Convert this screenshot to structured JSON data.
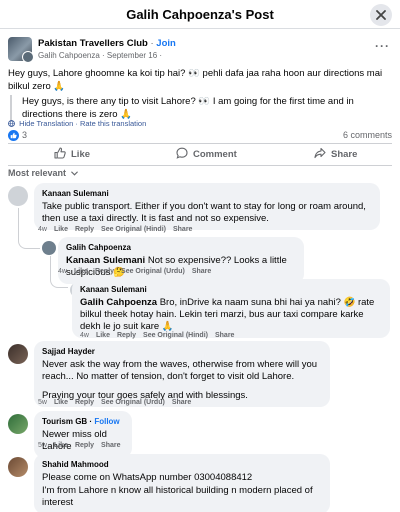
{
  "header": {
    "title": "Galih Cahpoenza's Post"
  },
  "post": {
    "group_name": "Pakistan Travellers Club",
    "dot": "·",
    "join_label": "Join",
    "author_line": "Galih Cahpoenza · September 16 ·",
    "more_label": "···",
    "text": "Hey guys, Lahore ghoomne ka koi tip hai? 👀 pehli dafa jaa raha hoon aur directions mai bilkul zero 🙏",
    "translated": "Hey guys, is there any tip to visit Lahore? 👀 I am going for the first time and in directions there is zero 🙏",
    "hide_translation": "Hide Translation",
    "rate_translation": "Rate this translation",
    "like_count": "3",
    "comment_count": "6 comments"
  },
  "actions": {
    "like": "Like",
    "comment": "Comment",
    "share": "Share"
  },
  "sort_label": "Most relevant",
  "comments": [
    {
      "name": "Kanaan Sulemani",
      "text": "Take public transport. Either if you don't want to stay for long or roam around, then use a taxi directly. It is fast and not so expensive.",
      "meta": [
        "4w",
        "Like",
        "Reply",
        "See Original (Hindi)",
        "Share"
      ]
    },
    {
      "name": "Galih Cahpoenza",
      "mention": "Kanaan Sulemani",
      "text": " Not so expensive?? Looks a little suspicious 🤔",
      "meta": [
        "4w",
        "Like",
        "Reply",
        "See Original (Urdu)",
        "Share"
      ]
    },
    {
      "name": "Kanaan Sulemani",
      "mention": "Galih Cahpoenza",
      "text": " Bro, inDrive ka naam suna bhi hai ya nahi? 🤣 rate bilkul theek hotay hain. Lekin teri marzi, bus aur taxi compare karke dekh le jo suit kare 🙏",
      "meta": [
        "4w",
        "Like",
        "Reply",
        "See Original (Hindi)",
        "Share"
      ]
    },
    {
      "name": "Sajjad Hayder",
      "text": "Never ask the way from the waves, otherwise from where will you reach... No matter of tension, don't forget to visit old Lahore.",
      "text2": "Praying your tour goes safely and with blessings.",
      "meta": [
        "5w",
        "Like",
        "Reply",
        "See Original (Urdu)",
        "Share"
      ]
    },
    {
      "name": "Tourism GB",
      "dot": "·",
      "follow": "Follow",
      "text": "Newer miss old Lahore",
      "meta": [
        "5w",
        "Like",
        "Reply",
        "Share"
      ]
    },
    {
      "name": "Shahid Mahmood",
      "text": "Please come on WhatsApp number 03004088412",
      "text2": "I'm from Lahore n know all historical building n modern placed of interest",
      "meta": []
    }
  ],
  "colors": {
    "accent": "#1877f2",
    "bubble": "#f0f2f5",
    "muted": "#65676b"
  },
  "icons": [
    "close-icon",
    "like-icon",
    "comment-icon",
    "share-icon",
    "translate-icon",
    "chevron-down-icon"
  ]
}
